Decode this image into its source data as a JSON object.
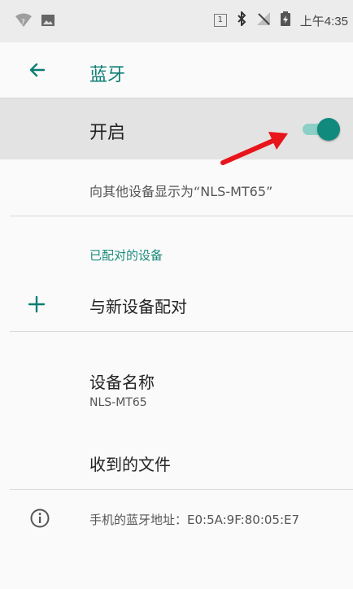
{
  "status_bar": {
    "sim_badge": "1",
    "time": "上午4:35",
    "icons": [
      "wifi-question-icon",
      "image-icon",
      "bluetooth-icon",
      "signal-off-icon",
      "battery-icon"
    ]
  },
  "toolbar": {
    "title": "蓝牙",
    "back_icon": "arrow-left-icon"
  },
  "bluetooth_toggle": {
    "label": "开启",
    "state": "on",
    "accent_color": "#108a7d"
  },
  "visible_as": "向其他设备显示为“NLS-MT65”",
  "paired_devices": {
    "header": "已配对的设备",
    "pair_new_label": "与新设备配对"
  },
  "device_name": {
    "title": "设备名称",
    "value": "NLS-MT65"
  },
  "received_files": "收到的文件",
  "address_info": "手机的蓝牙地址：E0:5A:9F:80:05:E7",
  "annotation": {
    "type": "red-arrow",
    "color": "#e8141b",
    "points_to": "bluetooth-toggle-switch"
  }
}
